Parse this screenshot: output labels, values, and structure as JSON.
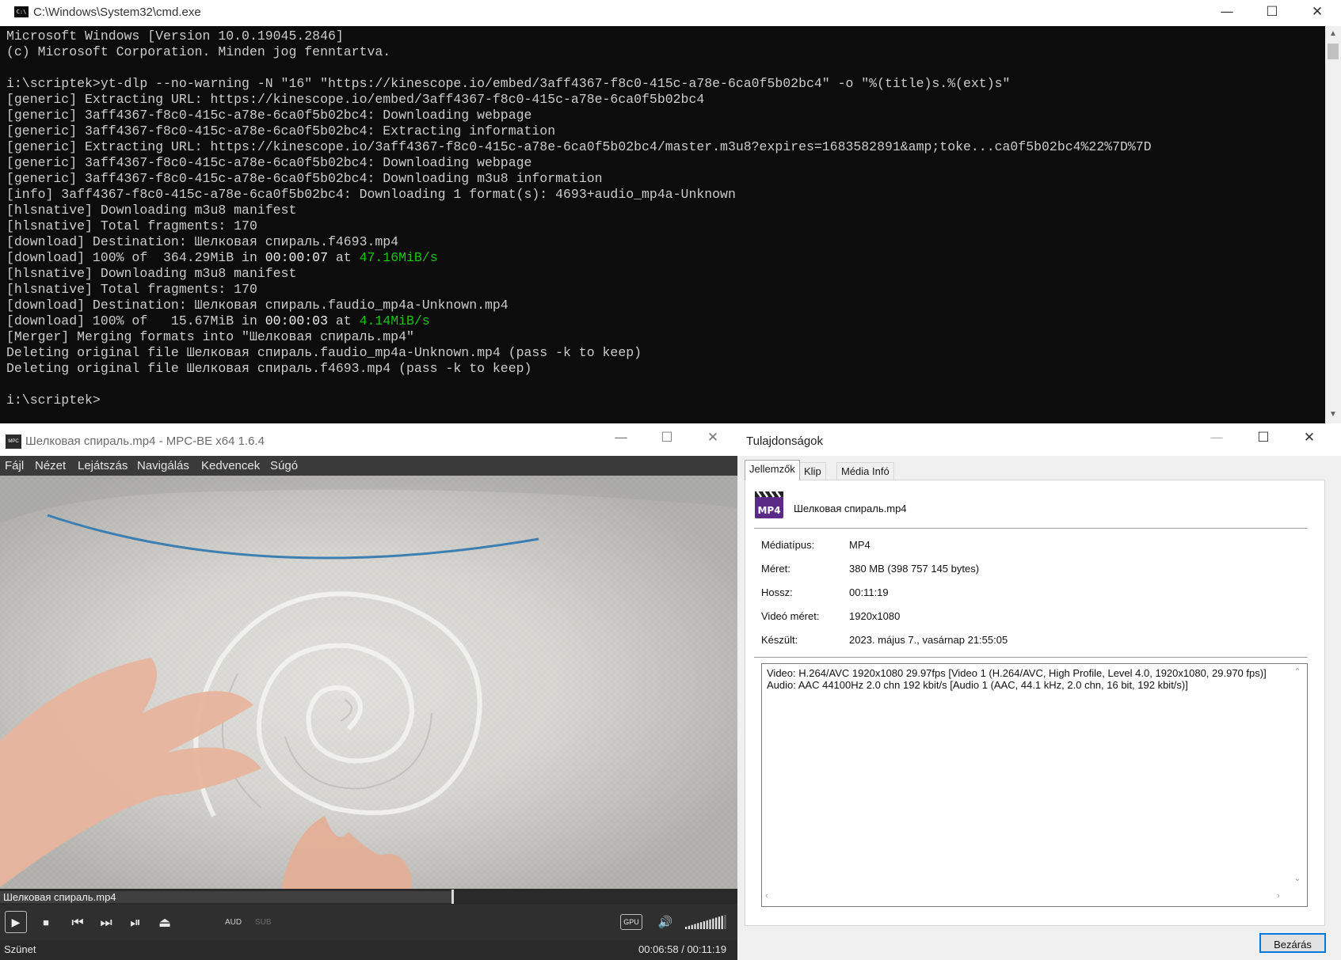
{
  "cmd": {
    "title": "C:\\Windows\\System32\\cmd.exe",
    "icon": "cmd-console-icon",
    "icon_text": "C:\\",
    "controls": {
      "minimize": "—",
      "maximize": "☐",
      "close": "✕"
    },
    "lines": [
      "Microsoft Windows [Version 10.0.19045.2846]",
      "(c) Microsoft Corporation. Minden jog fenntartva.",
      "",
      "i:\\scriptek>yt-dlp --no-warning -N \"16\" \"https://kinescope.io/embed/3aff4367-f8c0-415c-a78e-6ca0f5b02bc4\" -o \"%(title)s.%(ext)s\"",
      "[generic] Extracting URL: https://kinescope.io/embed/3aff4367-f8c0-415c-a78e-6ca0f5b02bc4",
      "[generic] 3aff4367-f8c0-415c-a78e-6ca0f5b02bc4: Downloading webpage",
      "[generic] 3aff4367-f8c0-415c-a78e-6ca0f5b02bc4: Extracting information",
      "[generic] Extracting URL: https://kinescope.io/3aff4367-f8c0-415c-a78e-6ca0f5b02bc4/master.m3u8?expires=1683582891&amp;toke...ca0f5b02bc4%22%7D%7D",
      "[generic] 3aff4367-f8c0-415c-a78e-6ca0f5b02bc4: Downloading webpage",
      "[generic] 3aff4367-f8c0-415c-a78e-6ca0f5b02bc4: Downloading m3u8 information",
      "[info] 3aff4367-f8c0-415c-a78e-6ca0f5b02bc4: Downloading 1 format(s): 4693+audio_mp4a-Unknown",
      "[hlsnative] Downloading m3u8 manifest",
      "[hlsnative] Total fragments: 170",
      "[download] Destination: Шелковая спираль.f4693.mp4",
      {
        "prefix": "[download] 100% of  364.29MiB in ",
        "time": "00:00:07",
        "mid": " at ",
        "speed": "47.16MiB/s"
      },
      "[hlsnative] Downloading m3u8 manifest",
      "[hlsnative] Total fragments: 170",
      "[download] Destination: Шелковая спираль.faudio_mp4a-Unknown.mp4",
      {
        "prefix": "[download] 100% of   15.67MiB in ",
        "time": "00:00:03",
        "mid": " at ",
        "speed": "4.14MiB/s"
      },
      "[Merger] Merging formats into \"Шелковая спираль.mp4\"",
      "Deleting original file Шелковая спираль.faudio_mp4a-Unknown.mp4 (pass -k to keep)",
      "Deleting original file Шелковая спираль.f4693.mp4 (pass -k to keep)",
      "",
      "i:\\scriptek>"
    ],
    "colors": {
      "background": "#0c0c0c",
      "text": "#cccccc",
      "speed": "#16c60c"
    }
  },
  "mpc": {
    "title": "Шелковая спираль.mp4 - MPC-BE x64 1.6.4",
    "icon": "mpc-be-clapper-icon",
    "icon_text": "MPC",
    "controls": {
      "minimize": "—",
      "maximize": "☐",
      "close": "✕"
    },
    "menu": [
      "Fájl",
      "Nézet",
      "Lejátszás",
      "Navigálás",
      "Kedvencek",
      "Súgó"
    ],
    "seek_filename": "Шелковая спираль.mp4",
    "seek_progress": 0.617,
    "buttons": {
      "play": "▶",
      "stop": "■",
      "prev": "⏮",
      "next": "⏭",
      "frame_step": "⏯",
      "eject": "⏏",
      "aud": "AUD",
      "sub": "SUB",
      "gpu": "GPU",
      "volume": "🔊"
    },
    "volume_level": 0.9,
    "status_left": "Szünet",
    "status_time": "00:06:58 / 00:11:19"
  },
  "props": {
    "title": "Tulajdonságok",
    "controls": {
      "minimize": "—",
      "maximize": "☐",
      "close": "✕"
    },
    "tabs": [
      "Jellemzők",
      "Klip",
      "Média Infó"
    ],
    "active_tab": "Jellemzők",
    "file_icon": "mp4-clapper-icon",
    "file_icon_text": "MP4",
    "file_name": "Шелковая спираль.mp4",
    "fields": [
      {
        "label": "Médiatípus:",
        "value": "MP4"
      },
      {
        "label": "Méret:",
        "value": "380 MB (398 757 145 bytes)"
      },
      {
        "label": "Hossz:",
        "value": "00:11:19"
      },
      {
        "label": "Videó méret:",
        "value": "1920x1080"
      },
      {
        "label": "Készült:",
        "value": "2023. május 7., vasárnap 21:55:05"
      }
    ],
    "info_lines": [
      "Video: H.264/AVC 1920x1080 29.97fps [Video 1 (H.264/AVC, High Profile, Level 4.0, 1920x1080, 29.970 fps)]",
      "Audio: AAC 44100Hz 2.0 chn 192 kbit/s [Audio 1 (AAC, 44.1 kHz, 2.0 chn, 16 bit, 192 kbit/s)]"
    ],
    "close_button": "Bezárás",
    "accent": "#0078d7"
  }
}
